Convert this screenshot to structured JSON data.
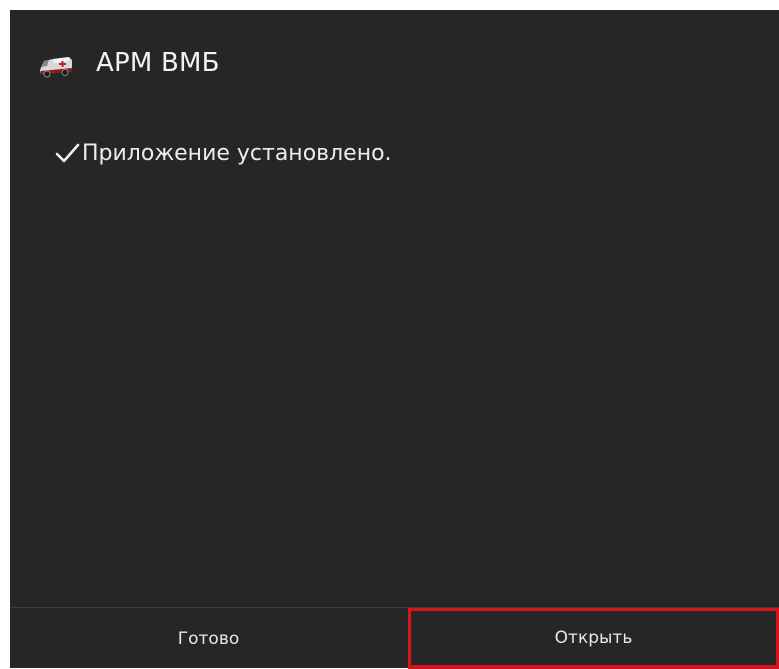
{
  "header": {
    "app_icon": "ambulance-icon",
    "app_title": "АРМ ВМБ"
  },
  "status": {
    "icon": "checkmark-icon",
    "message": "Приложение установлено."
  },
  "footer": {
    "done_label": "Готово",
    "open_label": "Открыть",
    "highlight_color": "#d9131b"
  },
  "colors": {
    "background": "#262626",
    "text": "#f2f2f2"
  }
}
